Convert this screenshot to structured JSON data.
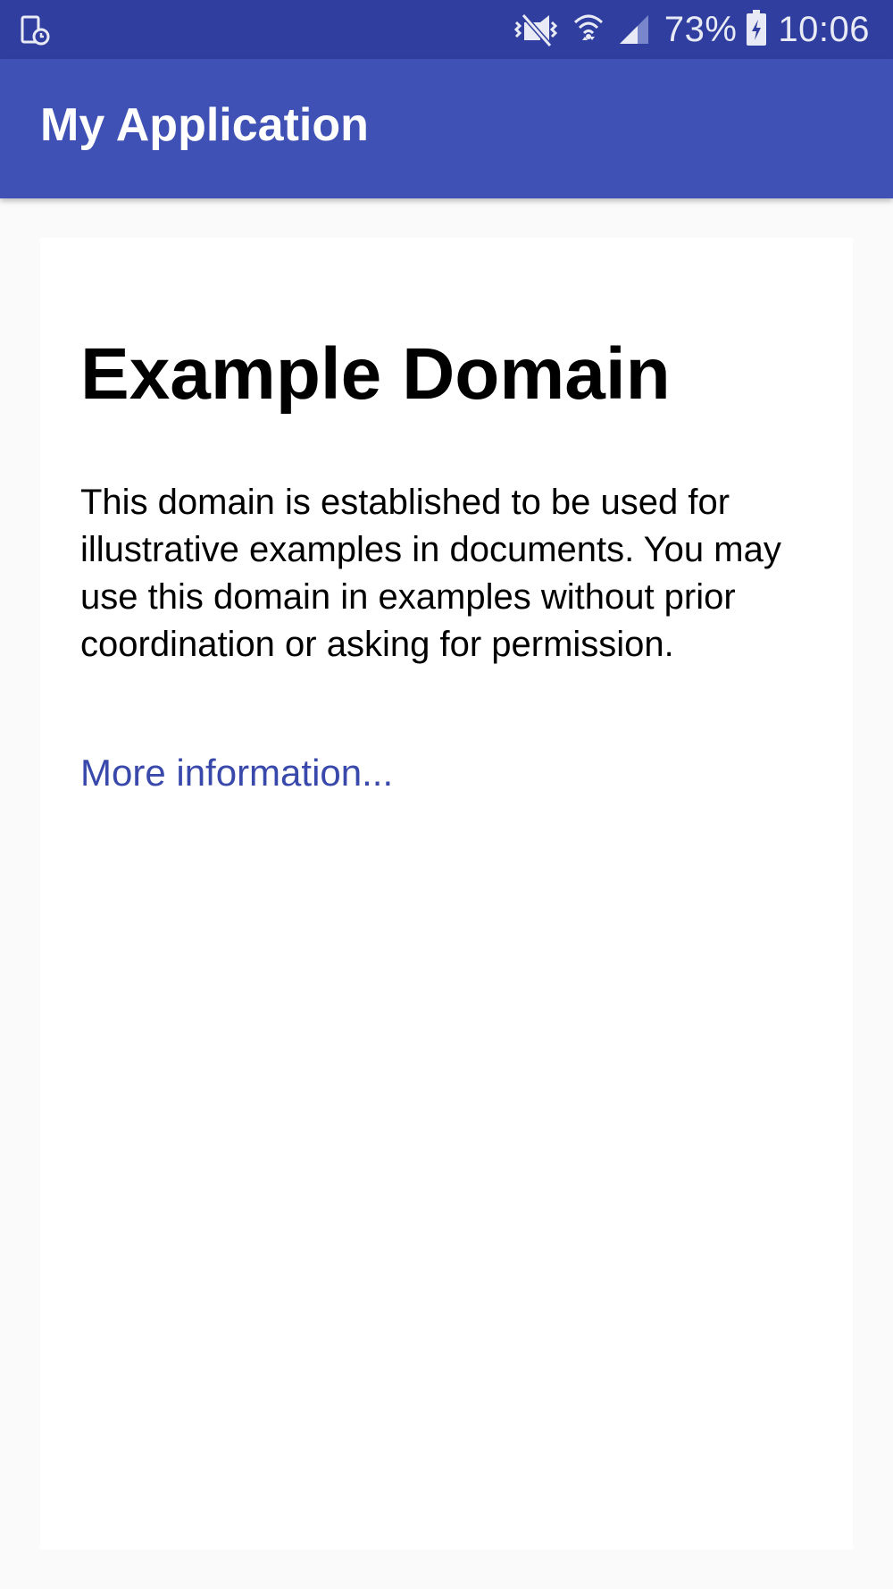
{
  "status_bar": {
    "left_icon": "screen-recorder-icon",
    "icons": [
      "vibrate-mute-icon",
      "wifi-icon",
      "signal-icon",
      "battery-charging-icon"
    ],
    "battery_percent": "73%",
    "time": "10:06",
    "background_color": "#303f9f"
  },
  "app_bar": {
    "title": "My Application",
    "background_color": "#3f51b5"
  },
  "content": {
    "heading": "Example Domain",
    "paragraph": "This domain is established to be used for illustrative examples in documents. You may use this domain in examples without prior coordination or asking for permission.",
    "link_text": "More information...",
    "link_color": "#3949ab"
  }
}
